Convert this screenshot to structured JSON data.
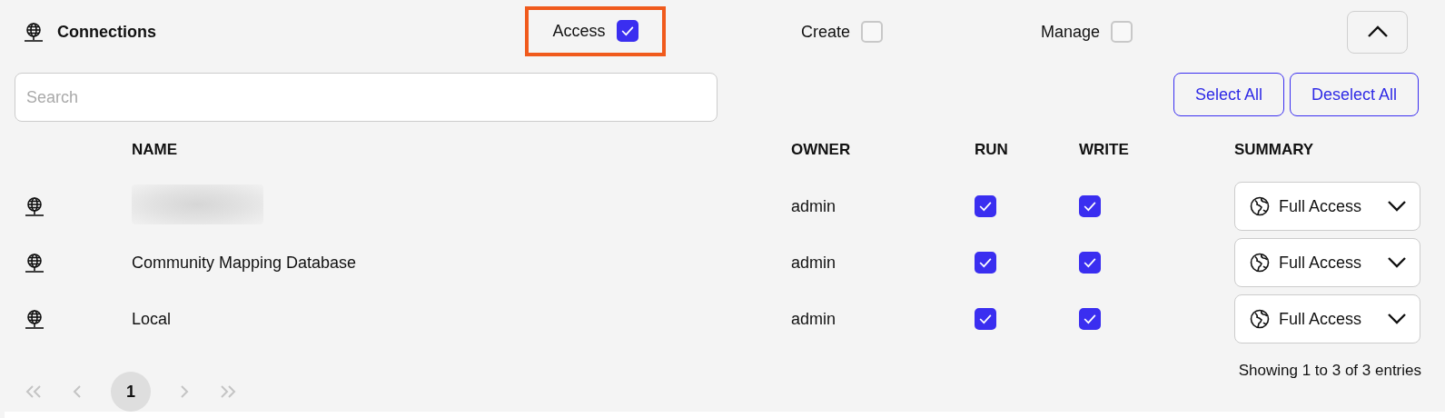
{
  "section": {
    "title": "Connections",
    "expanded": true
  },
  "permissions": [
    {
      "label": "Access",
      "checked": true,
      "highlighted": true
    },
    {
      "label": "Create",
      "checked": false,
      "highlighted": false
    },
    {
      "label": "Manage",
      "checked": false,
      "highlighted": false
    }
  ],
  "search": {
    "placeholder": "Search"
  },
  "buttons": [
    "Select All",
    "Deselect All"
  ],
  "table": {
    "columns": [
      "NAME",
      "OWNER",
      "RUN",
      "WRITE",
      "SUMMARY"
    ],
    "rows": [
      {
        "name_redacted": true,
        "owner": "admin",
        "run": true,
        "write": true,
        "summary": "Full Access"
      },
      {
        "name": "Community Mapping Database",
        "name_redacted": false,
        "owner": "admin",
        "run": true,
        "write": true,
        "summary": "Full Access"
      },
      {
        "name": "Local",
        "name_redacted": false,
        "owner": "admin",
        "run": true,
        "write": true,
        "summary": "Full Access"
      }
    ]
  },
  "status": "Showing 1 to 3 of 3 entries",
  "pagination": {
    "first_disabled": true,
    "prev_disabled": true,
    "pages": [
      {
        "label": "1",
        "selected": true
      }
    ],
    "next_disabled": true,
    "last_disabled": true
  }
}
